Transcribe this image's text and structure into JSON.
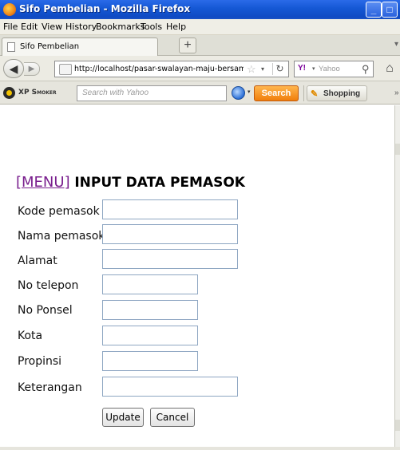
{
  "window": {
    "title": "Sifo Pembelian - Mozilla Firefox",
    "controls": {
      "minimize": "_",
      "maximize": "□",
      "close": "X"
    }
  },
  "menu": [
    "File",
    "Edit",
    "View",
    "History",
    "Bookmarks",
    "Tools",
    "Help"
  ],
  "tab": {
    "label": "Sifo Pembelian",
    "new_tab": "+"
  },
  "navigation": {
    "url": "http://localhost/pasar-swalayan-maju-bersama/input-pe",
    "search_placeholder": "Yahoo",
    "search_engine_icon": "yahoo-icon"
  },
  "toolbar": {
    "brand": "XP Smoker",
    "search_placeholder": "Search with Yahoo",
    "search_button": "Search",
    "shopping": "Shopping"
  },
  "page": {
    "menu_link": "[MENU]",
    "title": "INPUT DATA PEMASOK"
  },
  "form": {
    "fields": [
      {
        "label": "Kode pemasok",
        "value": ""
      },
      {
        "label": "Nama pemasok",
        "value": ""
      },
      {
        "label": "Alamat",
        "value": ""
      },
      {
        "label": "No telepon",
        "value": ""
      },
      {
        "label": "No Ponsel",
        "value": ""
      },
      {
        "label": "Kota",
        "value": ""
      },
      {
        "label": "Propinsi",
        "value": ""
      },
      {
        "label": "Keterangan",
        "value": ""
      }
    ],
    "update_button": "Update",
    "cancel_button": "Cancel"
  }
}
